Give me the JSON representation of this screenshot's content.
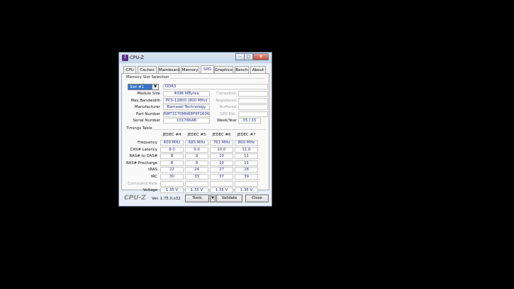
{
  "window": {
    "title": "CPU-Z",
    "icon": "cpuz-icon"
  },
  "tabs": [
    "CPU",
    "Caches",
    "Mainboard",
    "Memory",
    "SPD",
    "Graphics",
    "Bench",
    "About"
  ],
  "active_tab": "SPD",
  "slot": {
    "group_title": "Memory Slot Selection",
    "selected": "Slot #1",
    "type": "DDR3",
    "module_size_label": "Module Size",
    "module_size": "4096 MBytes",
    "max_bandwidth_label": "Max Bandwidth",
    "max_bandwidth": "PC3-12800 (800 MHz)",
    "manufacturer_label": "Manufacturer",
    "manufacturer": "Ramaxel Technology",
    "part_number_label": "Part Number",
    "part_number": "RMT3170MN68F9F1600",
    "serial_number_label": "Serial Number",
    "serial_number": "101766AB",
    "correction_label": "Correction",
    "registered_label": "Registered",
    "buffered_label": "Buffered",
    "spd_ext_label": "SPD Ext.",
    "week_year_label": "Week/Year",
    "week_year": "35 / 15"
  },
  "timings": {
    "group_title": "Timings Table",
    "columns": [
      "JEDEC #4",
      "JEDEC #5",
      "JEDEC #6",
      "JEDEC #7"
    ],
    "rows": [
      {
        "label": "Frequency",
        "values": [
          "609 MHz",
          "685 MHz",
          "761 MHz",
          "800 MHz"
        ]
      },
      {
        "label": "CAS# Latency",
        "values": [
          "8.0",
          "9.0",
          "10.0",
          "11.0"
        ]
      },
      {
        "label": "RAS# to CAS#",
        "values": [
          "8",
          "9",
          "10",
          "11"
        ]
      },
      {
        "label": "RAS# Precharge",
        "values": [
          "8",
          "9",
          "10",
          "11"
        ]
      },
      {
        "label": "tRAS",
        "values": [
          "22",
          "24",
          "27",
          "28"
        ]
      },
      {
        "label": "tRC",
        "values": [
          "30",
          "33",
          "37",
          "39"
        ]
      },
      {
        "label": "Command Rate",
        "values": [
          "",
          "",
          "",
          ""
        ]
      },
      {
        "label": "Voltage",
        "values": [
          "1.35 V",
          "1.35 V",
          "1.35 V",
          "1.35 V"
        ]
      }
    ]
  },
  "footer": {
    "brand": "CPU-Z",
    "version": "Ver. 1.75.0.x32",
    "tools_label": "Tools",
    "validate_label": "Validate",
    "close_label": "Close"
  }
}
